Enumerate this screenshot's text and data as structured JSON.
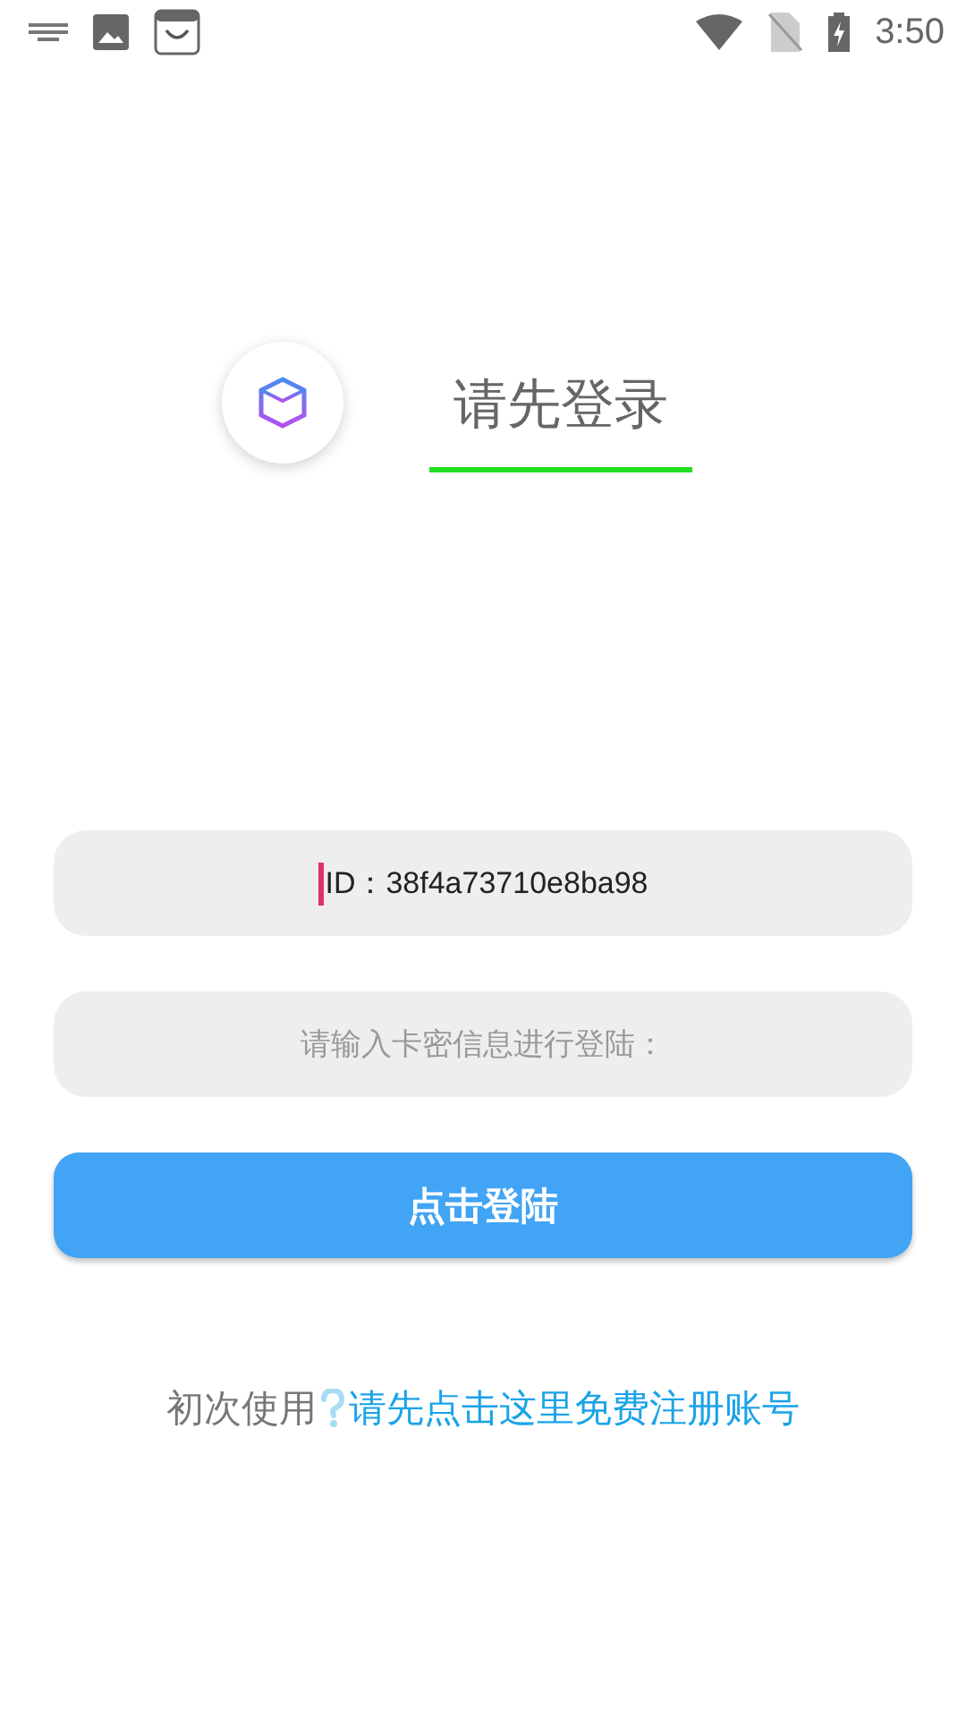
{
  "status_bar": {
    "time": "3:50"
  },
  "header": {
    "title": "请先登录"
  },
  "id_field": {
    "value": "ID：38f4a73710e8ba98",
    "focused": true
  },
  "key_field": {
    "placeholder": "请输入卡密信息进行登陆："
  },
  "login_button": {
    "label": "点击登陆"
  },
  "register": {
    "prefix": "初次使用",
    "link": "请先点击这里免费注册账号"
  }
}
